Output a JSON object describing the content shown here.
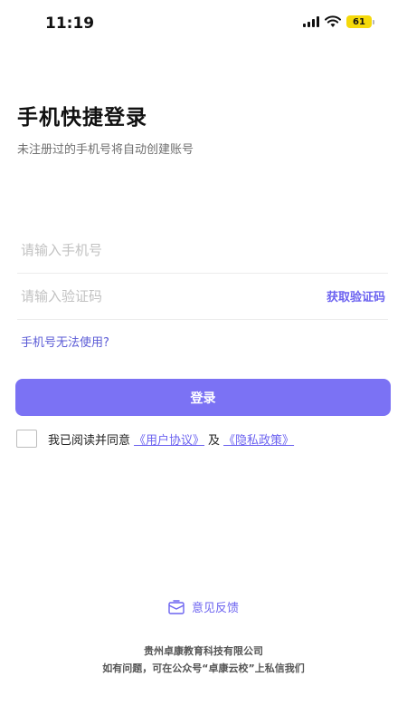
{
  "status_bar": {
    "time": "11:19",
    "battery": "61"
  },
  "login": {
    "title": "手机快捷登录",
    "subtitle": "未注册过的手机号将自动创建账号",
    "phone_placeholder": "请输入手机号",
    "code_placeholder": "请输入验证码",
    "get_code": "获取验证码",
    "phone_unavailable": "手机号无法使用?",
    "login_button": "登录"
  },
  "agreement": {
    "prefix": "我已阅读并同意",
    "user_agreement": "《用户协议》",
    "and": "及",
    "privacy_policy": "《隐私政策》"
  },
  "feedback": {
    "label": "意见反馈"
  },
  "footer": {
    "company": "贵州卓康教育科技有限公司",
    "contact": "如有问题，可在公众号“卓康云校”上私信我们"
  },
  "colors": {
    "accent": "#7b72f4",
    "link": "#6c63f0",
    "battery": "#f5d90a"
  }
}
